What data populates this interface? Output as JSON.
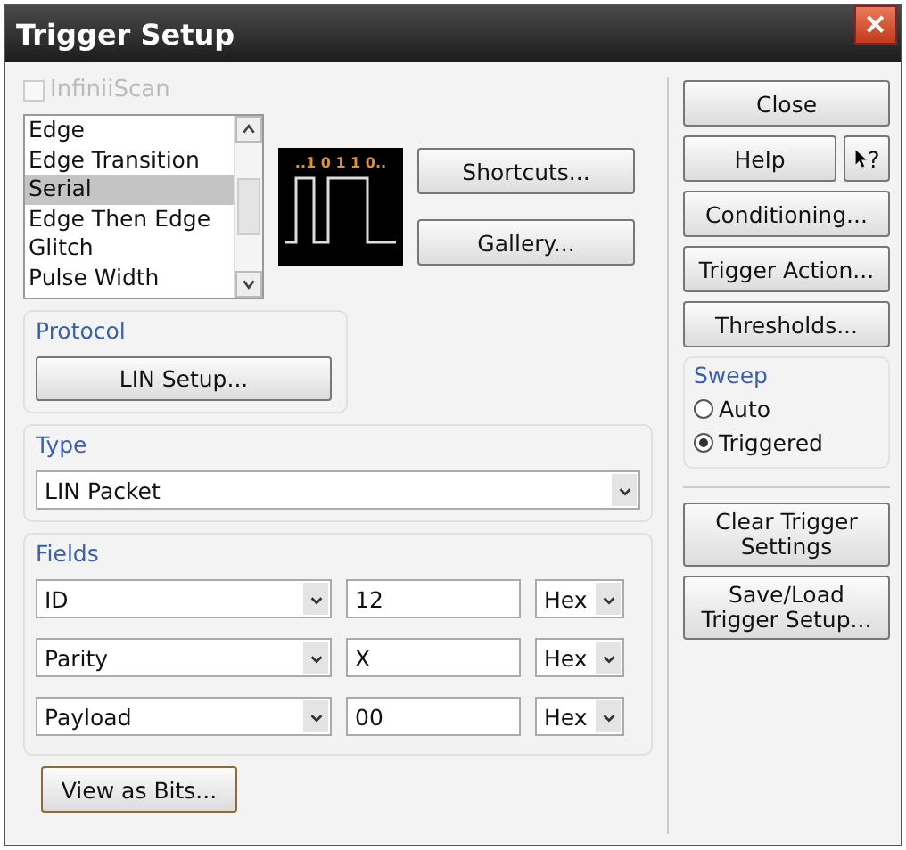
{
  "window": {
    "title": "Trigger Setup",
    "close": "✕"
  },
  "infiniscan": {
    "label": "InfiniiScan",
    "checked": false,
    "disabled": true
  },
  "trigger_types": [
    {
      "label": "Edge",
      "selected": false
    },
    {
      "label": "Edge Transition",
      "selected": false
    },
    {
      "label": "Serial",
      "selected": true
    },
    {
      "label": "Edge Then Edge",
      "selected": false
    },
    {
      "label": "Glitch",
      "selected": false
    },
    {
      "label": "Pulse Width",
      "selected": false
    }
  ],
  "preview": {
    "bits": "..1 0 1 1 0.."
  },
  "shortcut_buttons": [
    "Shortcuts...",
    "Gallery..."
  ],
  "protocol": {
    "title": "Protocol",
    "button": "LIN Setup..."
  },
  "type": {
    "title": "Type",
    "value": "LIN Packet"
  },
  "fields": {
    "title": "Fields",
    "rows": [
      {
        "name": "ID",
        "value": "12",
        "format": "Hex"
      },
      {
        "name": "Parity",
        "value": "X",
        "format": "Hex"
      },
      {
        "name": "Payload",
        "value": "00",
        "format": "Hex"
      }
    ]
  },
  "view_button": "View as Bits...",
  "side_buttons": {
    "close": "Close",
    "help": "Help",
    "whats_this": "?",
    "more": [
      "Conditioning...",
      "Trigger Action...",
      "Thresholds..."
    ]
  },
  "sweep": {
    "title": "Sweep",
    "options": [
      {
        "label": "Auto",
        "selected": false
      },
      {
        "label": "Triggered",
        "selected": true
      }
    ]
  },
  "bottom_buttons": [
    "Clear Trigger Settings",
    "Save/Load Trigger Setup..."
  ]
}
